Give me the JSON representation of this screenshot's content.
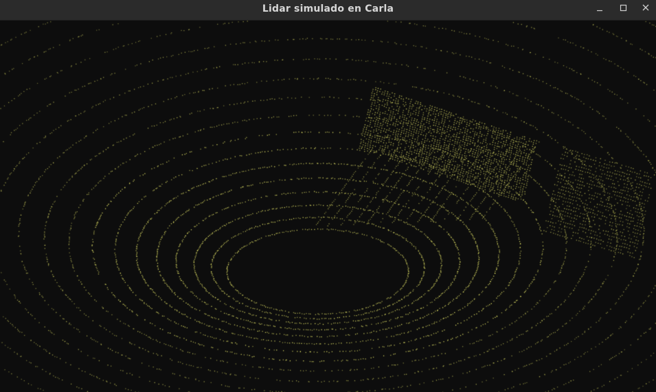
{
  "window": {
    "title": "Lidar simulado en Carla",
    "buttons": {
      "minimize_icon": "minimize-icon",
      "maximize_icon": "maximize-icon",
      "close_icon": "close-icon"
    }
  },
  "viewport": {
    "content": "lidar-point-cloud",
    "background_color": "#0d0d0d",
    "point_color": "#e8e86a"
  }
}
